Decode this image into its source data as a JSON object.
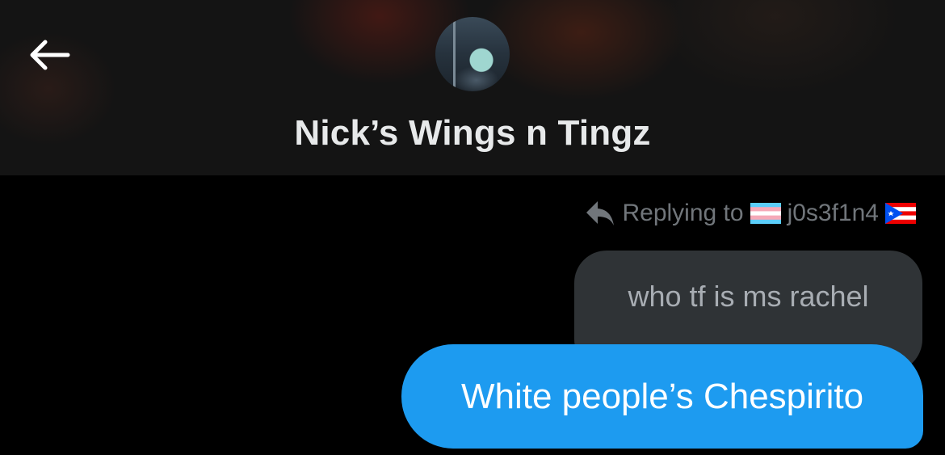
{
  "header": {
    "title": "Nick’s Wings n Tingz",
    "back_icon": "arrow-left-icon",
    "avatar_icon": "profile-avatar"
  },
  "reply": {
    "prefix": "Replying to",
    "username": "j0s3f1n4",
    "icons": [
      "reply-arrow-icon",
      "trans-flag-icon",
      "puerto-rico-flag-icon"
    ]
  },
  "messages": [
    {
      "direction": "incoming",
      "text": "who tf is ms rachel"
    },
    {
      "direction": "outgoing",
      "text": "White people’s Chespirito"
    }
  ],
  "colors": {
    "background": "#000000",
    "header": "#141414",
    "outgoing_bubble": "#1d9bf0",
    "incoming_bubble": "#2f3336",
    "muted_text": "#71767b"
  }
}
